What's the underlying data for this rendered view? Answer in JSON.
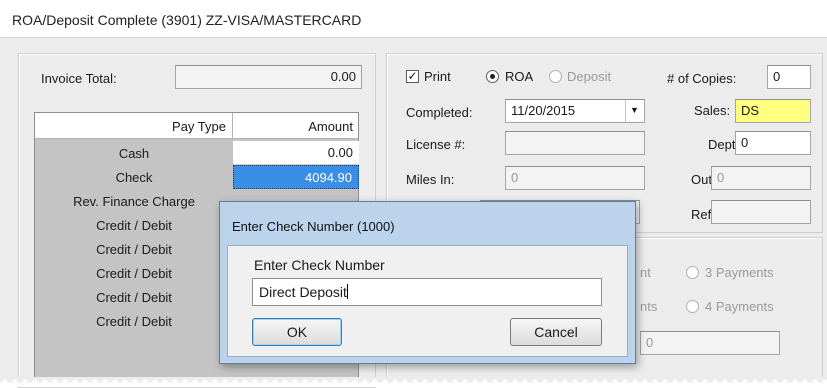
{
  "window": {
    "title": "ROA/Deposit Complete (3901) ZZ-VISA/MASTERCARD"
  },
  "left": {
    "invoice_total_label": "Invoice Total:",
    "invoice_total_value": "0.00",
    "columns": [
      "Pay Type",
      "Amount"
    ],
    "rows": [
      {
        "pay_type": "Cash",
        "amount": "0.00"
      },
      {
        "pay_type": "Check",
        "amount": "4094.90"
      },
      {
        "pay_type": "Rev. Finance Charge",
        "amount": ""
      },
      {
        "pay_type": "Credit / Debit",
        "amount": ""
      },
      {
        "pay_type": "Credit / Debit",
        "amount": ""
      },
      {
        "pay_type": "Credit / Debit",
        "amount": ""
      },
      {
        "pay_type": "Credit / Debit",
        "amount": ""
      },
      {
        "pay_type": "Credit / Debit",
        "amount": ""
      }
    ]
  },
  "right": {
    "print_label": "Print",
    "print_checked": true,
    "roa_label": "ROA",
    "deposit_label": "Deposit",
    "selected_mode": "ROA",
    "copies_label": "# of Copies:",
    "copies_value": "0",
    "completed_label": "Completed:",
    "completed_value": "11/20/2015",
    "sales_label": "Sales:",
    "sales_value": "DS",
    "license_label": "License #:",
    "license_value": "",
    "dept_label": "Dept:",
    "dept_value": "0",
    "miles_in_label": "Miles In:",
    "miles_in_value": "0",
    "out_label": "Out:",
    "out_value": "0",
    "ref_label": "Ref:",
    "ref_value": "",
    "payments_partial_1": "nt",
    "payments_partial_2": "nts",
    "three_payments_label": "3 Payments",
    "four_payments_label": "4 Payments",
    "bottom_field_value": "0"
  },
  "dialog": {
    "title": "Enter Check Number (1000)",
    "label": "Enter Check Number",
    "input_value": "Direct Deposit",
    "ok_label": "OK",
    "cancel_label": "Cancel"
  }
}
